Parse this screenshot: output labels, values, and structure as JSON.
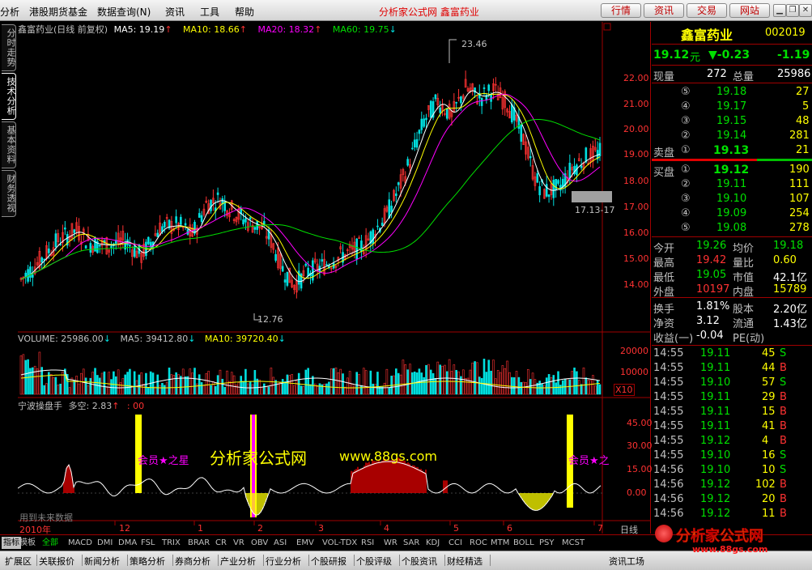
{
  "menu": {
    "items": [
      "分析",
      "港股期货基金",
      "数据查询(N)",
      "资讯",
      "工具",
      "帮助"
    ],
    "title": "分析家公式网  鑫富药业",
    "buttons": [
      "行情",
      "资讯",
      "交易",
      "网站"
    ]
  },
  "left_tabs": [
    "分时走势",
    "技术分析",
    "基本资料",
    "财务透视"
  ],
  "main_header": {
    "stock": "鑫富药业(日线 前复权)",
    "ma5": "MA5: 19.19",
    "ma10": "MA10: 18.66",
    "ma20": "MA20: 18.32",
    "ma60": "MA60: 19.75"
  },
  "price_axis": [
    "22.00",
    "21.00",
    "20.00",
    "19.00",
    "18.00",
    "17.00",
    "16.00",
    "15.00",
    "14.00"
  ],
  "price_marks": {
    "high": "23.46",
    "low": "12.76",
    "box": "17.13-17"
  },
  "volume_header": {
    "volume": "VOLUME: 25986.00",
    "ma5": "MA5: 39412.80",
    "ma10": "MA10: 39720.40"
  },
  "volume_axis": [
    "20000",
    "10000"
  ],
  "volume_unit": "X10",
  "indicator_header": {
    "name": "宁波操盘手",
    "value": "多空: 2.83",
    "extra": ": 00"
  },
  "indicator_axis": [
    "45.00",
    "30.00",
    "15.00",
    "0.00"
  ],
  "watermark": {
    "text": "分析家公式网",
    "url": "www.88gs.com",
    "star_left": "会员★之星",
    "star_right": "会员★之"
  },
  "future_note": "用到未来数据",
  "date_axis": [
    "2010年",
    "12",
    "1",
    "2",
    "3",
    "4",
    "5",
    "6",
    "7"
  ],
  "date_type": "日线",
  "quote": {
    "name": "鑫富药业",
    "code": "002019",
    "price": "19.12",
    "unit": "元",
    "change": "▼-0.23",
    "pct": "-1.19",
    "now_label": "现量",
    "now_val": "272",
    "total_label": "总量",
    "total_val": "25986",
    "sell": [
      [
        "⑤",
        "19.18",
        "27"
      ],
      [
        "④",
        "19.17",
        "5"
      ],
      [
        "③",
        "19.15",
        "48"
      ],
      [
        "②",
        "19.14",
        "281"
      ]
    ],
    "sell1": [
      "卖盘",
      "①",
      "19.13",
      "21"
    ],
    "buy1": [
      "买盘",
      "①",
      "19.12",
      "190"
    ],
    "buy": [
      [
        "②",
        "19.11",
        "111"
      ],
      [
        "③",
        "19.10",
        "107"
      ],
      [
        "④",
        "19.09",
        "254"
      ],
      [
        "⑤",
        "19.08",
        "278"
      ]
    ],
    "stats": [
      [
        "今开",
        "19.26",
        "均价",
        "19.18"
      ],
      [
        "最高",
        "19.42",
        "量比",
        "0.60"
      ],
      [
        "最低",
        "19.05",
        "市值",
        "42.1亿"
      ],
      [
        "外盘",
        "10197",
        "内盘",
        "15789"
      ]
    ],
    "stats2": [
      [
        "换手",
        "1.81%",
        "股本",
        "2.20亿"
      ],
      [
        "净资",
        "3.12",
        "流通",
        "1.43亿"
      ],
      [
        "收益(一)",
        "-0.04",
        "PE(动)",
        ""
      ]
    ],
    "ticks": [
      [
        "14:55",
        "19.11",
        "45",
        "S"
      ],
      [
        "14:55",
        "19.11",
        "44",
        "B"
      ],
      [
        "14:55",
        "19.10",
        "57",
        "S"
      ],
      [
        "14:55",
        "19.11",
        "29",
        "B"
      ],
      [
        "14:55",
        "19.11",
        "15",
        "B"
      ],
      [
        "14:55",
        "19.11",
        "41",
        "B"
      ],
      [
        "14:55",
        "19.12",
        "4",
        "B"
      ],
      [
        "14:55",
        "19.10",
        "16",
        "S"
      ],
      [
        "14:56",
        "19.10",
        "10",
        "S"
      ],
      [
        "14:56",
        "19.12",
        "102",
        "B"
      ],
      [
        "14:56",
        "19.12",
        "20",
        "B"
      ],
      [
        "14:56",
        "19.12",
        "11",
        "B"
      ]
    ]
  },
  "indicator_tabs": [
    "指标",
    "模板",
    "全部",
    "MACD",
    "DMI",
    "DMA",
    "FSL",
    "TRIX",
    "BRAR",
    "CR",
    "VR",
    "OBV",
    "ASI",
    "EMV",
    "VOL-TDX",
    "RSI",
    "WR",
    "SAR",
    "KDJ",
    "CCI",
    "ROC",
    "MTM",
    "BOLL",
    "PSY",
    "MCST"
  ],
  "bottom_tabs": [
    "扩展区",
    "关联报价",
    "新闻分析",
    "策略分析",
    "券商分析",
    "产业分析",
    "行业分析",
    "个股研报",
    "个股评级",
    "个股资讯",
    "财经精选"
  ],
  "bottom_right": "资讯工场",
  "logo": {
    "brand": "分析家公式网",
    "url": "www.88gs.com"
  }
}
